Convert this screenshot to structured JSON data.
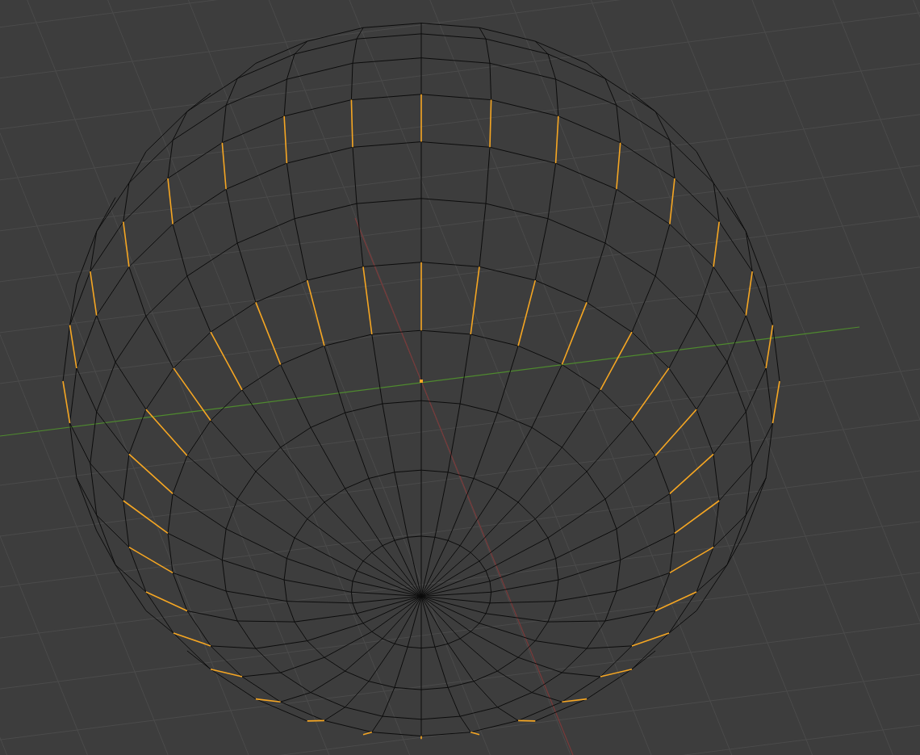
{
  "viewport": {
    "grid_visible": true,
    "x_axis_visible": true,
    "y_axis_visible": true
  },
  "sphere": {
    "edge_rings_selected": true
  }
}
